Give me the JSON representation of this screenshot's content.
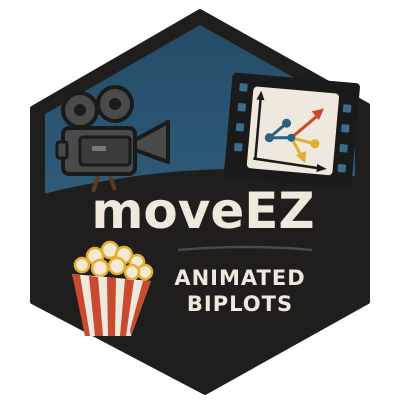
{
  "logo": {
    "title": "moveEZ",
    "subtitle_line1": "ANIMATED",
    "subtitle_line2": "BIPLOTS"
  },
  "icons": [
    "movie-camera-icon",
    "film-strip-biplot-icon",
    "popcorn-icon"
  ],
  "colors": {
    "hex_fill": "#1f1e1c",
    "sky": "#2c5b78",
    "text": "#efe8dc",
    "biplot_blue": "#2a5f86",
    "biplot_red": "#c9492a",
    "biplot_yellow": "#e2ae2c",
    "popcorn_red": "#c94a2e"
  }
}
